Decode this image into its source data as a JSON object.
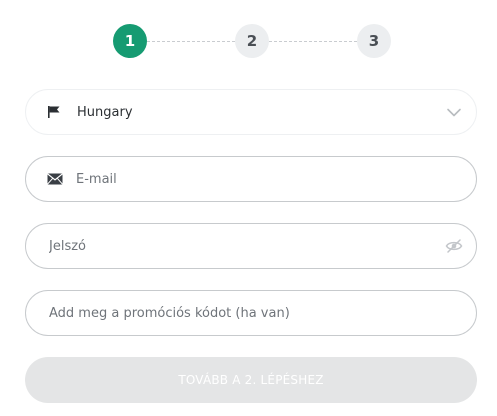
{
  "stepper": {
    "steps": [
      {
        "label": "1",
        "state": "active"
      },
      {
        "label": "2",
        "state": "inactive"
      },
      {
        "label": "3",
        "state": "inactive"
      }
    ],
    "active_color": "#169b72",
    "inactive_color": "#eceef0"
  },
  "country_select": {
    "icon": "flag-icon",
    "value": "Hungary"
  },
  "email_field": {
    "icon": "envelope-icon",
    "placeholder": "E-mail"
  },
  "password_field": {
    "placeholder": "Jelszó",
    "toggle_icon": "eye-off-icon"
  },
  "promo_field": {
    "placeholder": "Add meg a promóciós kódot (ha van)"
  },
  "submit_button": {
    "label": "TOVÁBB A 2. LÉPÉSHEZ"
  }
}
